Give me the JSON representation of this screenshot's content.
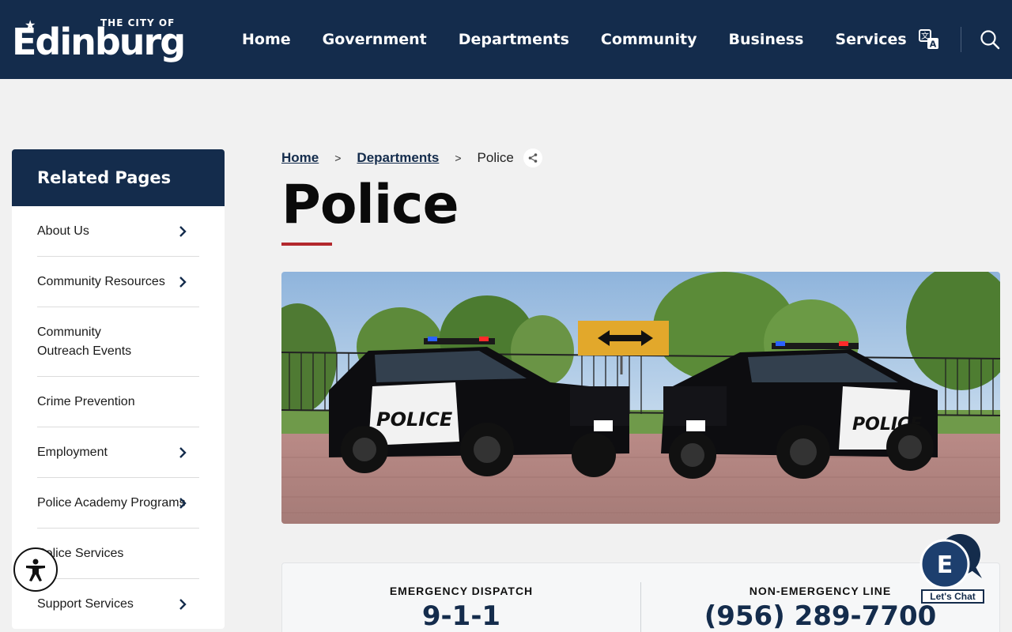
{
  "header": {
    "logo_small": "THE CITY OF",
    "logo_big": "Edinburg",
    "nav": [
      "Home",
      "Government",
      "Departments",
      "Community",
      "Business",
      "Services"
    ]
  },
  "sidebar": {
    "title": "Related Pages",
    "items": [
      {
        "label": "About Us",
        "has_children": true
      },
      {
        "label": "Community Resources",
        "has_children": true
      },
      {
        "label": "Community Outreach Events",
        "has_children": false
      },
      {
        "label": "Crime Prevention",
        "has_children": false
      },
      {
        "label": "Employment",
        "has_children": true
      },
      {
        "label": "Police Academy Programs",
        "has_children": true
      },
      {
        "label": "Police Services",
        "has_children": false
      },
      {
        "label": "Support Services",
        "has_children": true
      }
    ]
  },
  "breadcrumb": {
    "home": "Home",
    "separator": ">",
    "departments": "Departments",
    "current": "Police"
  },
  "page": {
    "title": "Police"
  },
  "contact": {
    "emergency_label": "EMERGENCY DISPATCH",
    "emergency_number": "9-1-1",
    "nonemergency_label": "NON-EMERGENCY LINE",
    "nonemergency_number": "(956) 289-7700"
  },
  "chat": {
    "label": "Let's Chat"
  },
  "colors": {
    "navy": "#142c4c",
    "accent_red": "#b3282d",
    "background": "#f1f1f1"
  },
  "icons": {
    "translate": "translate-icon",
    "search": "search-icon",
    "share": "share-icon",
    "chevron": "chevron-right-icon",
    "accessibility": "accessibility-icon",
    "chat": "chat-icon"
  }
}
